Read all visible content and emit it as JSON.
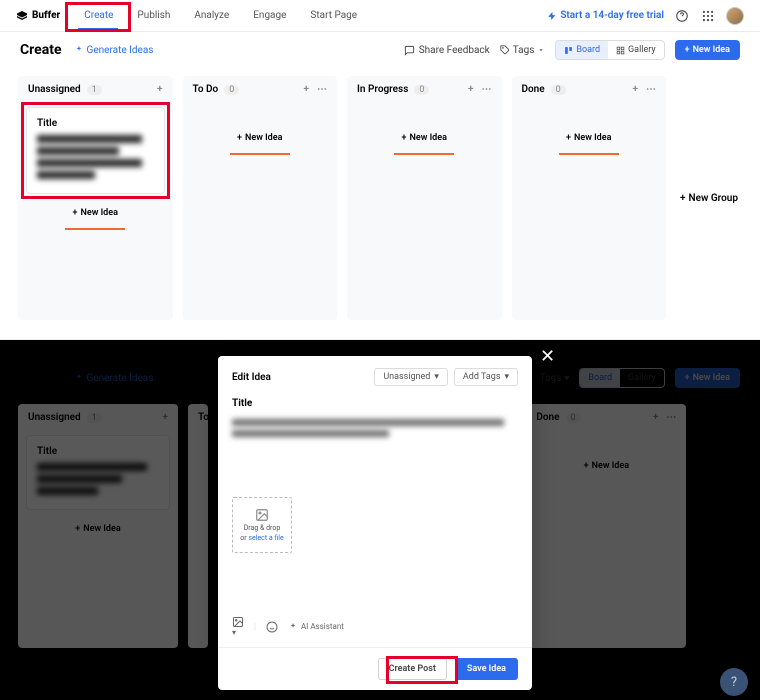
{
  "brand": "Buffer",
  "nav": {
    "items": [
      "Create",
      "Publish",
      "Analyze",
      "Engage",
      "Start Page"
    ],
    "active": "Create",
    "trial": "Start a 14-day free trial"
  },
  "page": {
    "title": "Create",
    "generate_ideas": "Generate Ideas",
    "share_feedback": "Share Feedback",
    "tags_label": "Tags",
    "view_board": "Board",
    "view_gallery": "Gallery",
    "new_idea": "New Idea",
    "new_group": "New Group"
  },
  "columns": [
    {
      "name": "Unassigned",
      "count": "1",
      "cards": [
        {
          "title": "Title"
        }
      ],
      "new_label": "New Idea"
    },
    {
      "name": "To Do",
      "count": "0",
      "new_label": "New Idea"
    },
    {
      "name": "In Progress",
      "count": "0",
      "new_label": "New Idea"
    },
    {
      "name": "Done",
      "count": "0",
      "new_label": "New Idea"
    }
  ],
  "modal": {
    "title": "Edit Idea",
    "pill_unassigned": "Unassigned",
    "pill_add_tags": "Add Tags",
    "body_title": "Title",
    "drop_label": "Drag & drop",
    "drop_or": "or",
    "drop_link": "select a file",
    "ai_assistant": "AI Assistant",
    "create_post": "Create Post",
    "save_idea": "Save Idea"
  },
  "help": "?"
}
